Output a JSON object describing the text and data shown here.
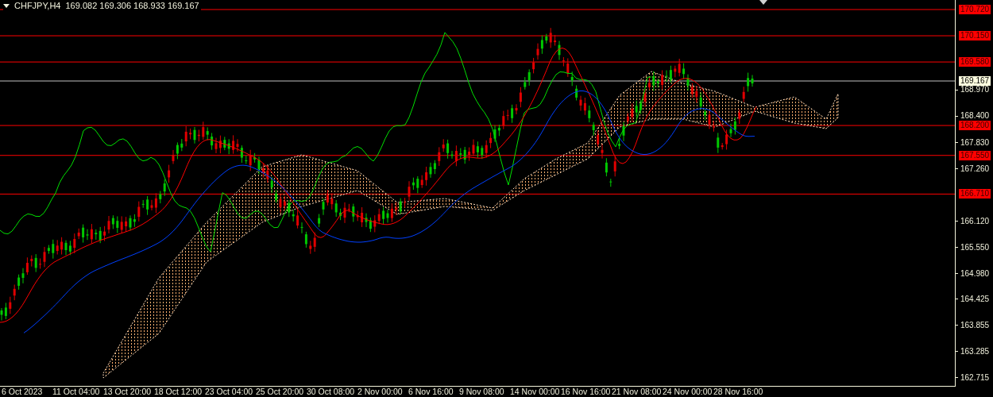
{
  "header": {
    "symbol": "CHFJPY,H4",
    "ohlc": "169.082 169.306 168.933 169.167"
  },
  "price_axis": {
    "ticks": [
      "168.970",
      "168.400",
      "167.830",
      "167.260",
      "166.120",
      "165.550",
      "164.980",
      "164.425",
      "163.855",
      "163.285",
      "162.715"
    ]
  },
  "levels": [
    {
      "label": "170.720",
      "kind": "level"
    },
    {
      "label": "170.150",
      "kind": "level"
    },
    {
      "label": "169.580",
      "kind": "level"
    },
    {
      "label": "169.167",
      "kind": "current"
    },
    {
      "label": "168.200",
      "kind": "level"
    },
    {
      "label": "167.550",
      "kind": "level"
    },
    {
      "label": "166.710",
      "kind": "level"
    }
  ],
  "time_axis": {
    "labels": [
      "6 Oct 2023",
      "11 Oct 04:00",
      "13 Oct 20:00",
      "18 Oct 12:00",
      "23 Oct 04:00",
      "25 Oct 20:00",
      "30 Oct 08:00",
      "2 Nov 00:00",
      "6 Nov 16:00",
      "9 Nov 08:00",
      "14 Nov 00:00",
      "16 Nov 16:00",
      "21 Nov 08:00",
      "24 Nov 00:00",
      "28 Nov 16:00"
    ]
  }
}
